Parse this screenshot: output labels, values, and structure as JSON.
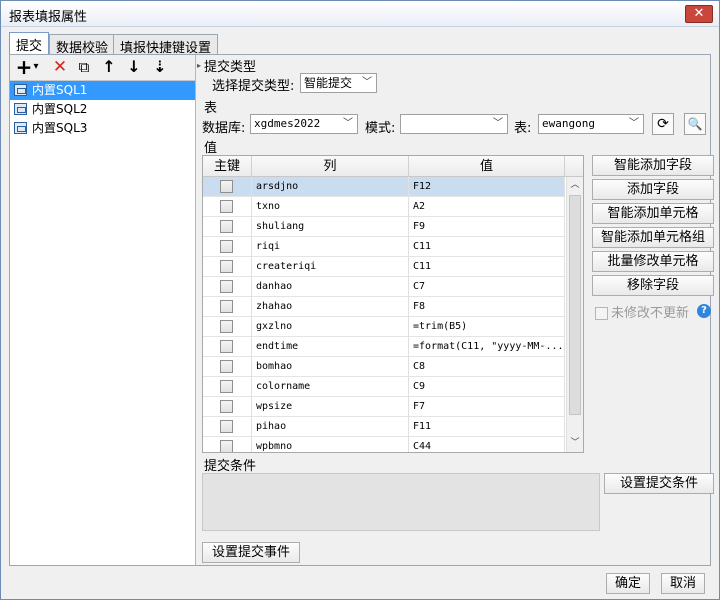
{
  "window": {
    "title": "报表填报属性",
    "close": "✕"
  },
  "tabs": [
    {
      "label": "提交",
      "active": true
    },
    {
      "label": "数据校验",
      "active": false
    },
    {
      "label": "填报快捷键设置",
      "active": false
    }
  ],
  "toolbar": {
    "add": "+",
    "add_menu": "▾",
    "delete": "✕",
    "copy": "⧉",
    "up": "↑",
    "down": "↓",
    "sort": "⇣"
  },
  "tree": {
    "items": [
      "内置SQL1",
      "内置SQL2",
      "内置SQL3"
    ],
    "selected_index": 0
  },
  "submit_type": {
    "section": "提交类型",
    "label": "选择提交类型:",
    "value": "智能提交"
  },
  "table_section": {
    "section": "表",
    "db_label": "数据库:",
    "db_value": "xgdmes2022",
    "mode_label": "模式:",
    "mode_value": "",
    "table_label": "表:",
    "table_value": "ewangong"
  },
  "value_section": {
    "section": "值",
    "columns": [
      "主键",
      "列",
      "值"
    ],
    "rows": [
      {
        "col": "arsdjno",
        "val": "F12",
        "selected": true
      },
      {
        "col": "txno",
        "val": "A2"
      },
      {
        "col": "shuliang",
        "val": "F9"
      },
      {
        "col": "riqi",
        "val": "C11"
      },
      {
        "col": "createriqi",
        "val": "C11"
      },
      {
        "col": "danhao",
        "val": "C7"
      },
      {
        "col": "zhahao",
        "val": "F8"
      },
      {
        "col": "gxzlno",
        "val": "=trim(B5)"
      },
      {
        "col": "endtime",
        "val": "=format(C11, \"yyyy-MM-..."
      },
      {
        "col": "bomhao",
        "val": "C8"
      },
      {
        "col": "colorname",
        "val": "C9"
      },
      {
        "col": "wpsize",
        "val": "F7"
      },
      {
        "col": "pihao",
        "val": "F11"
      },
      {
        "col": "wpbmno",
        "val": "C44"
      }
    ]
  },
  "side_buttons": {
    "smart_add_field": "智能添加字段",
    "add_field": "添加字段",
    "smart_add_cell": "智能添加单元格",
    "smart_add_cell_group": "智能添加单元格组",
    "batch_modify_cell": "批量修改单元格",
    "remove_field": "移除字段",
    "no_update_unchanged": "未修改不更新",
    "help": "?"
  },
  "condition": {
    "section": "提交条件",
    "set_button": "设置提交条件"
  },
  "event": {
    "set_button": "设置提交事件"
  },
  "footer": {
    "ok": "确定",
    "cancel": "取消"
  }
}
